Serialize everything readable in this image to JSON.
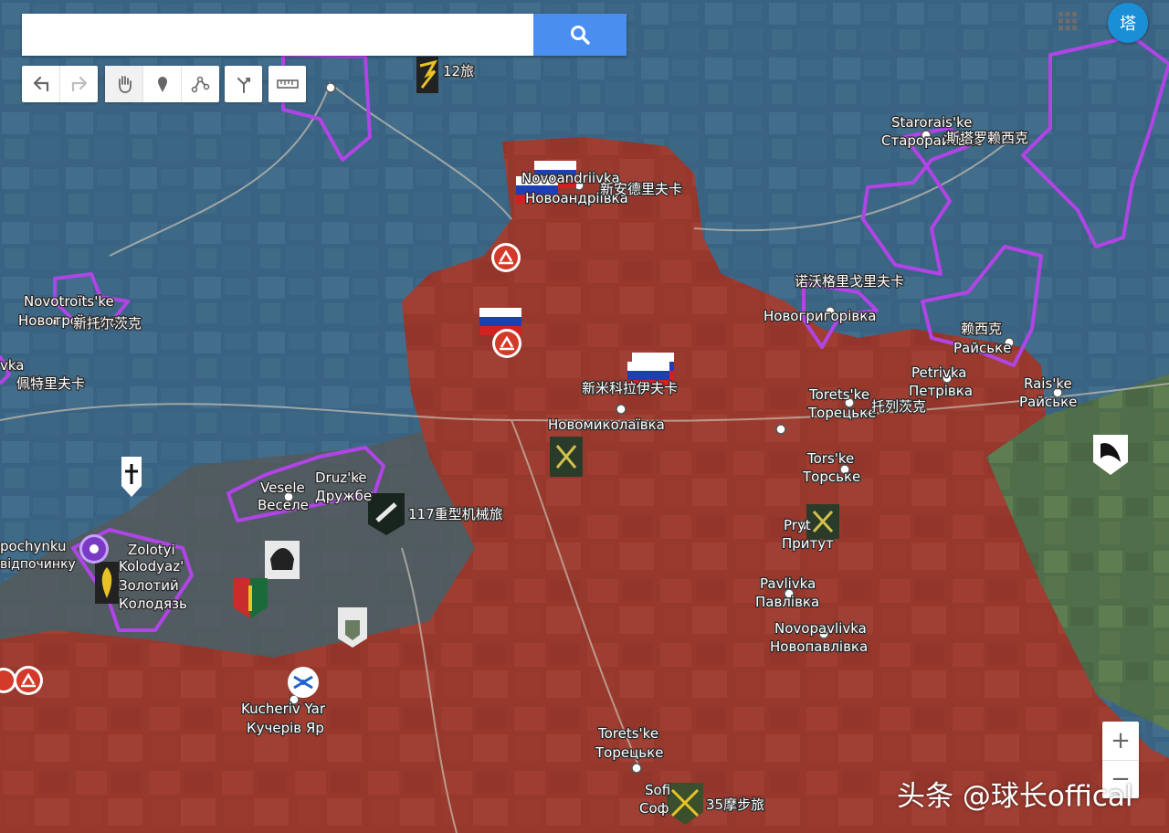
{
  "search": {
    "placeholder": ""
  },
  "toolbar": {
    "undo": "undo-icon",
    "redo": "redo-icon",
    "pan": "hand-icon",
    "marker": "marker-icon",
    "polyline": "polyline-icon",
    "route": "route-icon",
    "measure": "ruler-icon"
  },
  "account": {
    "avatar_text": "塔"
  },
  "zoom": {
    "in": "+",
    "out": "−"
  },
  "watermark": "头条 @球长offical",
  "places": {
    "novoandriivka": {
      "latin": "Novoandriivka",
      "cyrillic": "Новоандріївка",
      "zh": "新安德里夫卡"
    },
    "starorais": {
      "latin": "Starorais'ke",
      "cyrillic": "Старорайське",
      "zh": "斯塔罗赖西克"
    },
    "novotroitske": {
      "latin": "Novotroïts'ke",
      "cyrillic": "Новотроїцьке",
      "zh": "新托尔茨克"
    },
    "pishchanka": {
      "latin": "vka",
      "zh": "佩特里夫卡"
    },
    "novohryhorivka": {
      "zh": "诺沃格里戈里夫卡",
      "cyrillic": "Новогригорівка"
    },
    "raiske_zh": {
      "zh": "赖西克",
      "cyrillic": "Райське"
    },
    "raiske": {
      "latin": "Rais'ke",
      "cyrillic": "Райське"
    },
    "petrivka": {
      "latin": "Petrivka",
      "cyrillic": "Петрівка"
    },
    "toretske_n": {
      "latin": "Torets'ke",
      "cyrillic": "Торецьке",
      "zh": "托列茨克"
    },
    "novomykolaivka": {
      "zh": "新米科拉伊夫卡",
      "cyrillic": "Новомиколаївка"
    },
    "torske": {
      "latin": "Tors'ke",
      "cyrillic": "Торське"
    },
    "veselyi": {
      "latin": "Vesele",
      "cyrillic": "Веселе"
    },
    "druzhba": {
      "latin": "Druz'ke",
      "cyrillic": "Дружбе"
    },
    "prytut": {
      "latin": "Pryt",
      "cyrillic": "Притут"
    },
    "zolotyi": {
      "latin": "Zolotyi Kolodyaz'",
      "cyrillic": "Золотий Колодязь"
    },
    "pochynku": {
      "latin": "pochynku",
      "cyrillic": "відпочинку"
    },
    "pavlivka": {
      "latin": "Pavlivka",
      "cyrillic": "Павлівка"
    },
    "novopavlivka": {
      "latin": "Novopavlivka",
      "cyrillic": "Новопавлівка"
    },
    "kucheriv": {
      "latin": "Kucheriv Yar",
      "cyrillic": "Кучерів Яр"
    },
    "toretske_s": {
      "latin": "Torets'ke",
      "cyrillic": "Торецьке"
    },
    "sofiivka": {
      "latin": "Sofi",
      "cyrillic": "Соф"
    }
  },
  "units": {
    "brigade12": "12旅",
    "brigade117": "117重型机械旅",
    "brigade35": "35摩步旅"
  },
  "colors": {
    "ukraine_zone": "#3b6f93",
    "russia_zone": "#a0362c",
    "gray_zone": "#55595a",
    "border": "#b044e6"
  }
}
